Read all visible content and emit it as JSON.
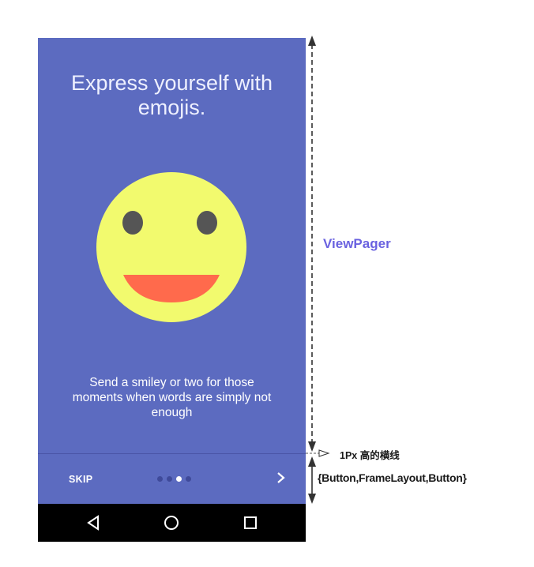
{
  "onboarding": {
    "headline": "Express yourself with emojis.",
    "body": "Send a smiley or two for those moments when words are simply not enough",
    "smiley_icon": "smiley-face-icon",
    "colors": {
      "background": "#5c6bc0",
      "smiley_face": "#f2fa6e",
      "smiley_eyes": "#555555",
      "smiley_mouth": "#ff6a4c"
    }
  },
  "bottom_bar": {
    "skip_label": "SKIP",
    "next_icon": "chevron-right-icon",
    "page_count": 4,
    "active_page": 3
  },
  "navbar": {
    "back_icon": "back-triangle-icon",
    "home_icon": "home-circle-icon",
    "recents_icon": "recents-square-icon"
  },
  "annotations": {
    "viewpager_label": "ViewPager",
    "divider_label": "1Px 高的横线",
    "bottom_bar_label": "{Button,FrameLayout,Button}"
  }
}
